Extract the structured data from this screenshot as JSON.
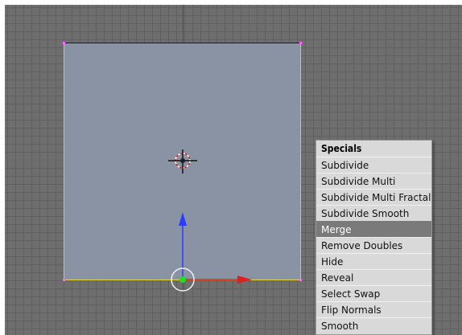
{
  "viewport": {
    "background": "#6e6e6e",
    "face_color": "#8a93a3",
    "selected_edge_color": "#e6dc3c"
  },
  "specials_menu": {
    "title": "Specials",
    "items": [
      {
        "label": "Subdivide",
        "active": false
      },
      {
        "label": "Subdivide Multi",
        "active": false
      },
      {
        "label": "Subdivide Multi Fractal",
        "active": false
      },
      {
        "label": "Subdivide Smooth",
        "active": false
      },
      {
        "label": "Merge",
        "active": true
      },
      {
        "label": "Remove Doubles",
        "active": false
      },
      {
        "label": "Hide",
        "active": false
      },
      {
        "label": "Reveal",
        "active": false
      },
      {
        "label": "Select Swap",
        "active": false
      },
      {
        "label": "Flip Normals",
        "active": false
      },
      {
        "label": "Smooth",
        "active": false
      }
    ]
  },
  "icons": {
    "cursor": "3d-cursor-icon",
    "manipulator": "transform-manipulator-icon"
  }
}
